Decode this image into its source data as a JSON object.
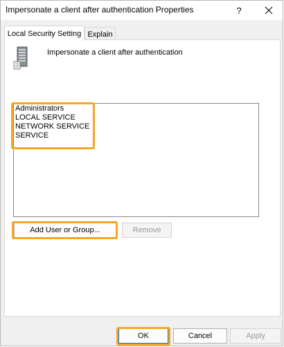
{
  "window": {
    "title": "Impersonate a client after authentication Properties"
  },
  "titlebar": {
    "help_label": "?"
  },
  "tabs": [
    {
      "label": "Local Security Setting",
      "active": true
    },
    {
      "label": "Explain",
      "active": false
    }
  ],
  "policy": {
    "name": "Impersonate a client after authentication",
    "icon": "server-icon"
  },
  "accounts": [
    "Administrators",
    "LOCAL SERVICE",
    "NETWORK SERVICE",
    "SERVICE"
  ],
  "buttons": {
    "add": "Add User or Group...",
    "remove": "Remove",
    "ok": "OK",
    "cancel": "Cancel",
    "apply": "Apply"
  },
  "colors": {
    "highlight": "#f5a623",
    "default_button_border": "#0078d7"
  }
}
